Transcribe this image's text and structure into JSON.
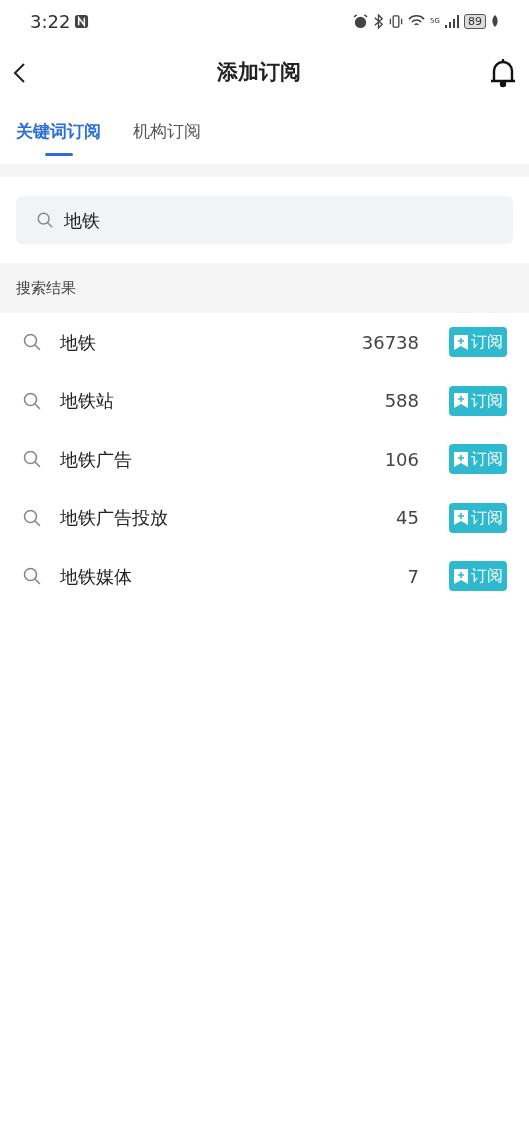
{
  "status_bar": {
    "time": "3:22",
    "network": "5G",
    "battery": "89"
  },
  "header": {
    "title": "添加订阅"
  },
  "tabs": [
    {
      "label": "关键词订阅",
      "selected": true
    },
    {
      "label": "机构订阅",
      "selected": false
    }
  ],
  "search": {
    "value": "地铁"
  },
  "results": {
    "heading": "搜索结果",
    "items": [
      {
        "keyword": "地铁",
        "count": "36738",
        "action": "订阅"
      },
      {
        "keyword": "地铁站",
        "count": "588",
        "action": "订阅"
      },
      {
        "keyword": "地铁广告",
        "count": "106",
        "action": "订阅"
      },
      {
        "keyword": "地铁广告投放",
        "count": "45",
        "action": "订阅"
      },
      {
        "keyword": "地铁媒体",
        "count": "7",
        "action": "订阅"
      }
    ]
  }
}
